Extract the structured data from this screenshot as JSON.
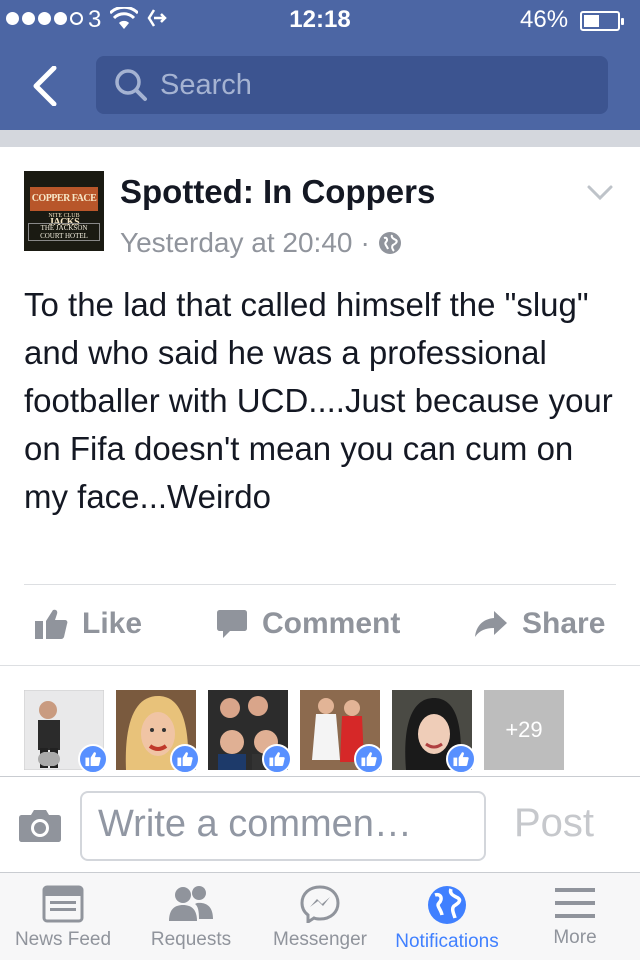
{
  "status_bar": {
    "carrier": "3",
    "time": "12:18",
    "battery_percent_label": "46%",
    "battery_level": 0.46
  },
  "nav": {
    "search_placeholder": "Search"
  },
  "post": {
    "page_name": "Spotted: In Coppers",
    "timestamp": "Yesterday at 20:40",
    "separator": "·",
    "avatar_sign": "COPPER FACE JACKS",
    "avatar_sub": "NITE CLUB",
    "avatar_sub2": "THE JACKSON COURT HOTEL",
    "text": "To the lad that called himself the \"slug\" and who said he was a professional footballer with UCD....Just because your on Fifa doesn't mean you can cum on my face...Weirdo",
    "actions": {
      "like": "Like",
      "comment": "Comment",
      "share": "Share"
    },
    "more_likes_label": "+29"
  },
  "composer": {
    "placeholder": "Write a commen…",
    "post_label": "Post"
  },
  "tabbar": {
    "items": [
      {
        "label": "News Feed",
        "icon": "news-feed-icon"
      },
      {
        "label": "Requests",
        "icon": "friend-requests-icon"
      },
      {
        "label": "Messenger",
        "icon": "messenger-icon"
      },
      {
        "label": "Notifications",
        "icon": "globe-icon"
      },
      {
        "label": "More",
        "icon": "menu-icon"
      }
    ],
    "active": "Notifications"
  },
  "colors": {
    "brand_blue": "#4c66a4",
    "active_tab": "#4080ff",
    "like_badge": "#5890ff"
  }
}
